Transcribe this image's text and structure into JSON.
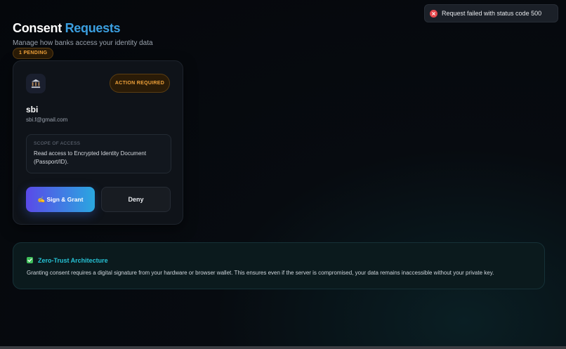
{
  "header": {
    "title_part1": "Consent",
    "title_part2": "Requests",
    "subtitle": "Manage how banks access your identity data",
    "pending_badge": "1 PENDING"
  },
  "request_card": {
    "icon": "bank-icon",
    "status_badge": "ACTION REQUIRED",
    "bank_name": "sbi",
    "email": "sbi.f@gmail.com",
    "scope_label": "SCOPE OF ACCESS",
    "scope_text": "Read access to Encrypted Identity Document (Passport/ID).",
    "grant_button": "✍️ Sign & Grant",
    "deny_button": "Deny"
  },
  "zero_trust": {
    "icon": "check-icon",
    "title": "Zero-Trust Architecture",
    "text": "Granting consent requires a digital signature from your hardware or browser wallet. This ensures even if the server is compromised, your data remains inaccessible without your private key."
  },
  "toast": {
    "icon": "error-icon",
    "message": "Request failed with status code 500"
  },
  "colors": {
    "accent_blue": "#3b9fe0",
    "warning": "#f0a23a",
    "teal": "#26c2d4",
    "error": "#e5484d",
    "success": "#3fbf5a"
  }
}
